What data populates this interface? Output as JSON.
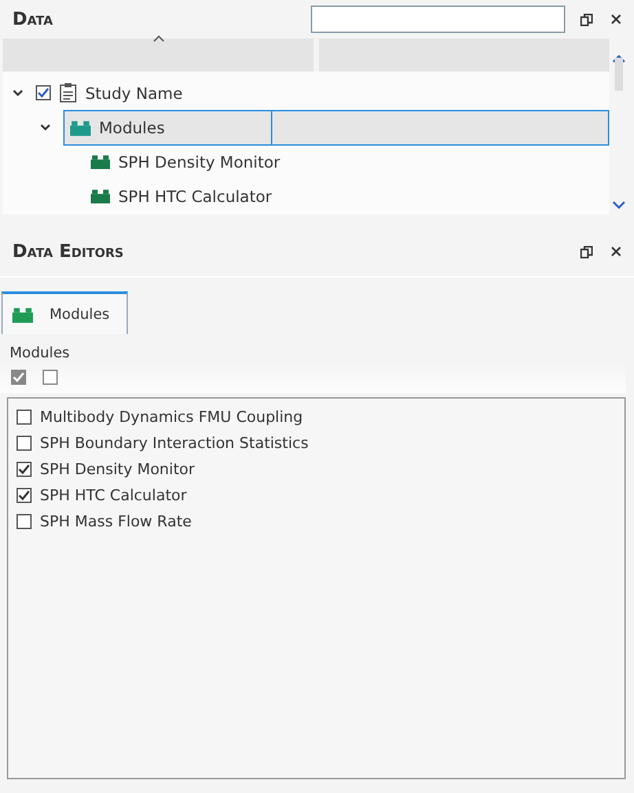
{
  "data_panel": {
    "title": "Data",
    "tree": [
      {
        "label": "Study Name",
        "kind": "study",
        "checked": true,
        "expanded": true,
        "selected": false,
        "children": [
          {
            "label": "Modules",
            "kind": "folder",
            "expanded": true,
            "selected": true,
            "children": [
              {
                "label": "SPH Density Monitor",
                "kind": "module",
                "selected": false
              },
              {
                "label": "SPH HTC Calculator",
                "kind": "module",
                "selected": false
              }
            ]
          }
        ]
      }
    ]
  },
  "editors_panel": {
    "title": "Data Editors",
    "tabs": [
      {
        "label": "Modules",
        "selected": true
      }
    ],
    "section_label": "Modules",
    "bulk_toggles": [
      {
        "checked": true
      },
      {
        "checked": false
      }
    ],
    "modules": [
      {
        "label": "Multibody Dynamics FMU Coupling",
        "checked": false
      },
      {
        "label": "SPH Boundary Interaction Statistics",
        "checked": false
      },
      {
        "label": "SPH Density Monitor",
        "checked": true
      },
      {
        "label": "SPH HTC Calculator",
        "checked": true
      },
      {
        "label": "SPH Mass Flow Rate",
        "checked": false
      }
    ]
  }
}
